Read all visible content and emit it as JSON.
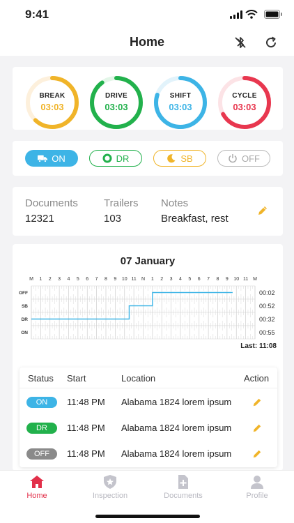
{
  "status_bar": {
    "time": "9:41"
  },
  "header": {
    "title": "Home",
    "icons": [
      "bluetooth-off-icon",
      "refresh-icon"
    ]
  },
  "gauges": [
    {
      "label": "BREAK",
      "value": "03:03",
      "color": "#f0b429",
      "track": "#fdf0dc",
      "progress": 0.62
    },
    {
      "label": "DRIVE",
      "value": "03:03",
      "color": "#22b14c",
      "track": "#e3f6e8",
      "progress": 0.9
    },
    {
      "label": "SHIFT",
      "value": "03:03",
      "color": "#3db4e6",
      "track": "#e2f3fb",
      "progress": 0.8
    },
    {
      "label": "CYCLE",
      "value": "03:03",
      "color": "#e8374f",
      "track": "#fce3e6",
      "progress": 0.67
    }
  ],
  "duty_status": {
    "on": {
      "label": "ON",
      "icon": "truck-icon",
      "color": "#3db4e6",
      "active": true
    },
    "dr": {
      "label": "DR",
      "icon": "circle-icon",
      "color": "#22b14c"
    },
    "sb": {
      "label": "SB",
      "icon": "moon-icon",
      "color": "#f0b429"
    },
    "off": {
      "label": "OFF",
      "icon": "power-icon",
      "color": "#aaaaaa"
    }
  },
  "info": {
    "documents": {
      "label": "Documents",
      "value": "12321"
    },
    "trailers": {
      "label": "Trailers",
      "value": "103"
    },
    "notes": {
      "label": "Notes",
      "value": "Breakfast, rest"
    }
  },
  "log": {
    "date": "07 January",
    "hour_labels": [
      "M",
      "1",
      "2",
      "3",
      "4",
      "5",
      "6",
      "7",
      "8",
      "9",
      "10",
      "11",
      "N",
      "1",
      "2",
      "3",
      "4",
      "5",
      "6",
      "7",
      "8",
      "9",
      "10",
      "11",
      "M"
    ],
    "rows": [
      "OFF",
      "SB",
      "DR",
      "ON"
    ],
    "totals": [
      "00:02",
      "00:52",
      "00:32",
      "00:55"
    ],
    "last_label": "Last: 11:08",
    "line_color": "#3db4e6"
  },
  "table": {
    "headers": {
      "status": "Status",
      "start": "Start",
      "location": "Location",
      "action": "Action"
    },
    "rows": [
      {
        "status": "ON",
        "color": "#3db4e6",
        "start": "11:48 PM",
        "location": "Alabama 1824 lorem ipsum"
      },
      {
        "status": "DR",
        "color": "#22b14c",
        "start": "11:48 PM",
        "location": "Alabama 1824 lorem ipsum"
      },
      {
        "status": "OFF",
        "color": "#8a8a8a",
        "start": "11:48 PM",
        "location": "Alabama 1824 lorem ipsum"
      }
    ]
  },
  "tabs": {
    "home": {
      "label": "Home",
      "icon": "home-icon",
      "active": true
    },
    "inspection": {
      "label": "Inspection",
      "icon": "shield-star-icon"
    },
    "documents": {
      "label": "Documents",
      "icon": "document-plus-icon"
    },
    "profile": {
      "label": "Profile",
      "icon": "user-icon"
    }
  },
  "colors": {
    "accent": "#e2304a",
    "pencil": "#f0b429"
  }
}
